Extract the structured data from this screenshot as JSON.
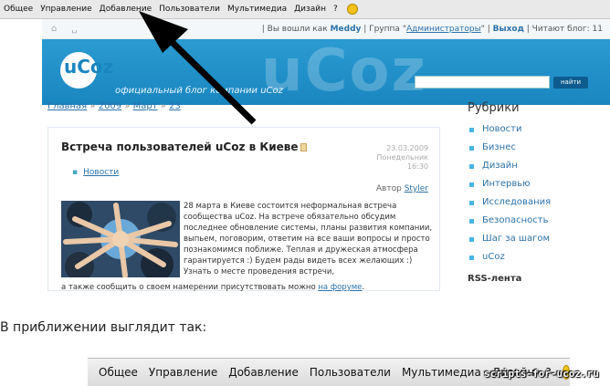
{
  "adminbar": {
    "items": [
      "Общее",
      "Управление",
      "Добавление",
      "Пользователи",
      "Мультимедиа",
      "Дизайн",
      "?"
    ]
  },
  "userbar": {
    "logged_as": "Вы вошли как",
    "user": "Meddy",
    "group_label": "Группа",
    "group": "Администраторы",
    "logout": "Выход",
    "readers": "Читают блог: 11"
  },
  "banner": {
    "logo": "uCoz",
    "big": "uCoz",
    "tagline": "официальный блог компании uCoz",
    "search_button": "найти"
  },
  "breadcrumb": {
    "home": "Главная",
    "year": "2009",
    "month": "Март",
    "day": "23",
    "sep": "»"
  },
  "post": {
    "title": "Встреча пользователей uCoz в Киеве",
    "date": "23.03.2009",
    "weekday": "Понедельник",
    "time": "16:30",
    "category": "Новости",
    "author_label": "Автор",
    "author": "Styler",
    "body": "28 марта в Киеве состоится неформальная встреча сообщества uCoz. На встрече обязательно обсудим последнее обновление системы, планы развития компании, выпьем, поговорим, ответим на все ваши вопросы и просто познакомимся поближе. Теплая и дружеская атмосфера гарантируется :) Будем рады видеть всех желающих :) Узнать о месте проведения встречи,",
    "tail": "а также сообщить о своем намерении присутствовать можно",
    "tail_link": "на форуме"
  },
  "sidebar": {
    "title": "Рубрики",
    "items": [
      "Новости",
      "Бизнес",
      "Дизайн",
      "Интервью",
      "Исследования",
      "Безопасность",
      "Шаг за шагом",
      "uCoz"
    ],
    "rss": "RSS-лента"
  },
  "caption": "В приближении выглядит так:",
  "zoombar": {
    "items": [
      "Общее",
      "Управление",
      "Добавление",
      "Пользователи",
      "Мультимедиа",
      "Дизайн",
      "?"
    ]
  },
  "watermark": "scripts-for-ucoz.ru",
  "colors": {
    "accent": "#2a72a8",
    "banner": "#1a86c0",
    "bullet": "#47b5e4"
  }
}
